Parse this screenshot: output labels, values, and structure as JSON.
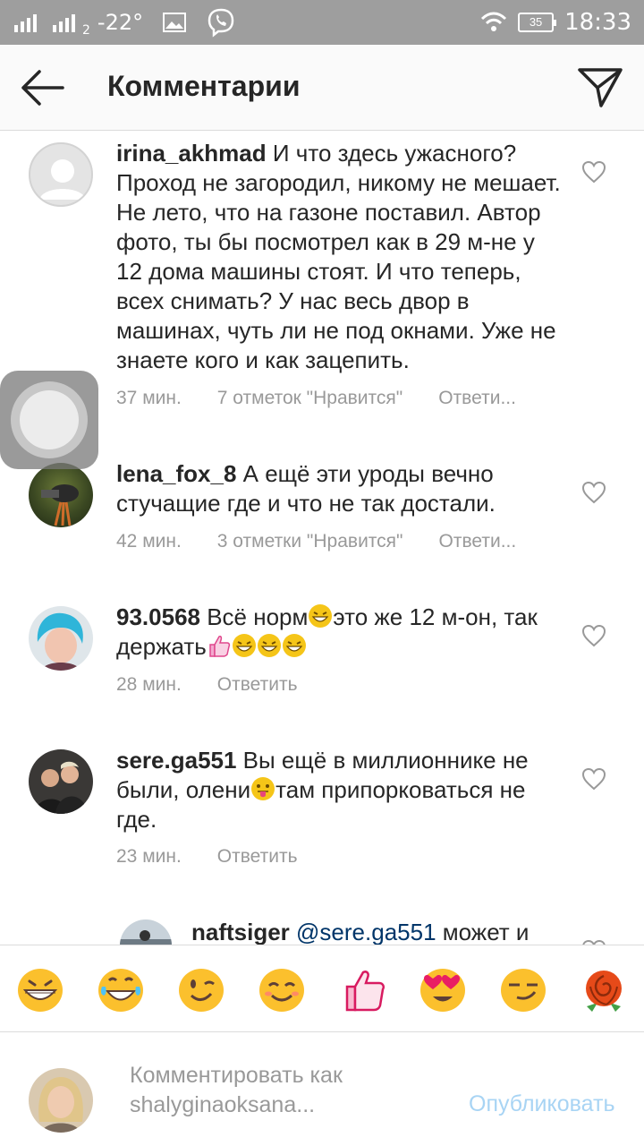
{
  "status_bar": {
    "signal_2": "2",
    "temperature": "-22°",
    "battery": "35",
    "time": "18:33"
  },
  "header": {
    "title": "Комментарии",
    "back_icon": "arrow-left-icon",
    "send_icon": "paper-plane-icon"
  },
  "comments": [
    {
      "username": "irina_akhmad",
      "text": " И что здесь ужасного? Проход не загородил, никому не мешает. Не лето, что на газоне поставил. Автор фото, ты бы посмотрел как в 29 м-не у 12 дома машины стоят. И что теперь, всех снимать? У нас весь двор в машинах, чуть ли не под окнами. Уже не знаете кого и как зацепить.",
      "time": "37 мин.",
      "likes": "7 отметок \"Нравится\"",
      "reply": "Ответи..."
    },
    {
      "username": "lena_fox_8",
      "text": " А ещё эти уроды вечно стучащие где и что не так достали.",
      "time": "42 мин.",
      "likes": "3 отметки \"Нравится\"",
      "reply": "Ответи..."
    },
    {
      "username": "93.0568",
      "text_1": " Всё норм",
      "text_2": "это же 12 м-он, так держать",
      "time": "28 мин.",
      "reply": "Ответить"
    },
    {
      "username": "sere.ga551",
      "text_1": " Вы ещё в миллионнике не были, олени",
      "text_2": "там припорковаться не где.",
      "time": "23 мин.",
      "reply": "Ответить"
    },
    {
      "username": "naftsiger",
      "mention": " @sere.ga551",
      "text": " может и"
    }
  ],
  "emoji_bar": [
    "grinning-face-icon",
    "tears-of-joy-face-icon",
    "winking-face-icon",
    "smiling-face-icon",
    "thumbs-up-icon",
    "heart-eyes-face-icon",
    "smirking-face-icon",
    "rose-icon"
  ],
  "composer": {
    "placeholder": "Комментировать как shalyginaoksana...",
    "publish_label": "Опубликовать"
  },
  "colors": {
    "status_bar": "#9e9e9e",
    "header_bg": "#fafafa",
    "link": "#003569",
    "publish_disabled": "#a8d4f4",
    "meta_text": "#999999"
  }
}
